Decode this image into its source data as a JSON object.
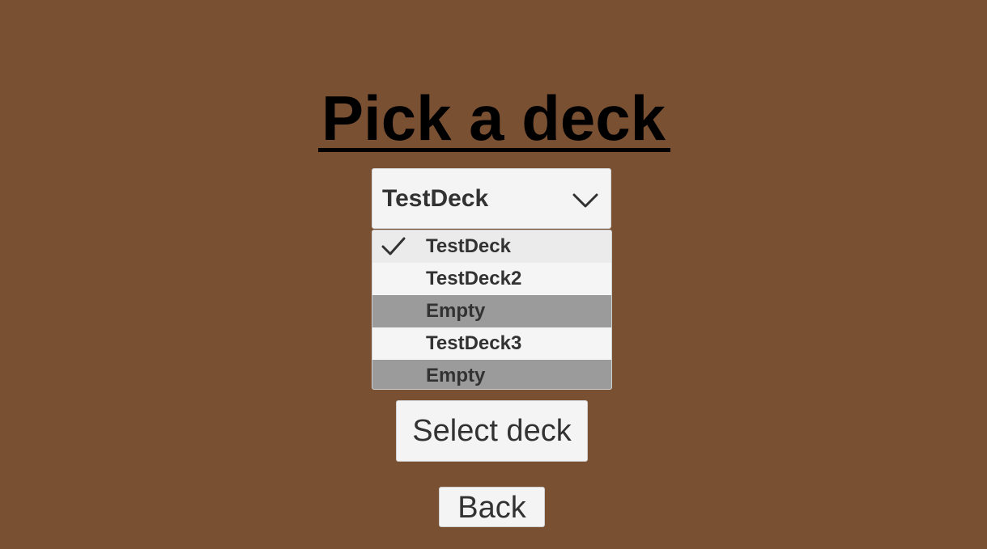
{
  "title": "Pick a deck",
  "dropdown": {
    "selected_label": "TestDeck",
    "arrow_icon": "chevron-down-icon",
    "options": [
      {
        "label": "TestDeck",
        "state": "selected"
      },
      {
        "label": "TestDeck2",
        "state": "normal"
      },
      {
        "label": "Empty",
        "state": "disabled"
      },
      {
        "label": "TestDeck3",
        "state": "normal"
      },
      {
        "label": "Empty",
        "state": "disabled"
      }
    ],
    "check_icon": "checkmark-icon"
  },
  "buttons": {
    "select_label": "Select deck",
    "back_label": "Back"
  },
  "colors": {
    "background": "#7A5033",
    "panel": "#F4F4F4",
    "empty_option": "#9B9B9B",
    "text": "#323232"
  }
}
